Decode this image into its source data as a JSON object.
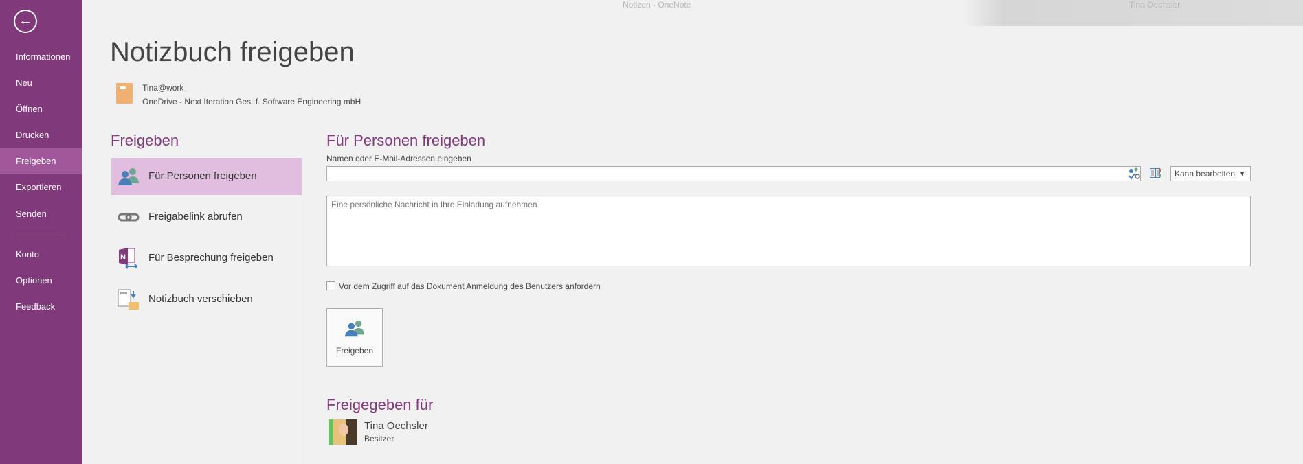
{
  "window": {
    "title": "Notizen - OneNote",
    "user": "Tina Oechsler"
  },
  "sidebar": {
    "items": [
      {
        "label": "Informationen"
      },
      {
        "label": "Neu"
      },
      {
        "label": "Öffnen"
      },
      {
        "label": "Drucken"
      },
      {
        "label": "Freigeben",
        "active": true
      },
      {
        "label": "Exportieren"
      },
      {
        "label": "Senden"
      },
      {
        "label": "Konto"
      },
      {
        "label": "Optionen"
      },
      {
        "label": "Feedback"
      }
    ]
  },
  "page": {
    "title": "Notizbuch freigeben",
    "notebook_name": "Tina@work",
    "notebook_location": "OneDrive - Next Iteration Ges. f. Software Engineering mbH"
  },
  "share_menu": {
    "heading": "Freigeben",
    "items": [
      {
        "label": "Für Personen freigeben",
        "icon": "people-icon",
        "active": true
      },
      {
        "label": "Freigabelink abrufen",
        "icon": "link-icon"
      },
      {
        "label": "Für Besprechung freigeben",
        "icon": "onenote-meeting-icon"
      },
      {
        "label": "Notizbuch verschieben",
        "icon": "move-notebook-icon"
      }
    ]
  },
  "share_people": {
    "heading": "Für Personen freigeben",
    "names_label": "Namen oder E-Mail-Adressen eingeben",
    "names_value": "",
    "permission": "Kann bearbeiten",
    "message_placeholder": "Eine persönliche Nachricht in Ihre Einladung aufnehmen",
    "require_signin_label": "Vor dem Zugriff auf das Dokument Anmeldung des Benutzers anfordern",
    "require_signin_checked": false,
    "share_button": "Freigeben"
  },
  "shared_with": {
    "heading": "Freigegeben für",
    "people": [
      {
        "name": "Tina Oechsler",
        "role": "Besitzer"
      }
    ]
  },
  "colors": {
    "accent": "#80397b",
    "sidebar_active": "#a0589a",
    "menu_active": "#e1bee0"
  }
}
